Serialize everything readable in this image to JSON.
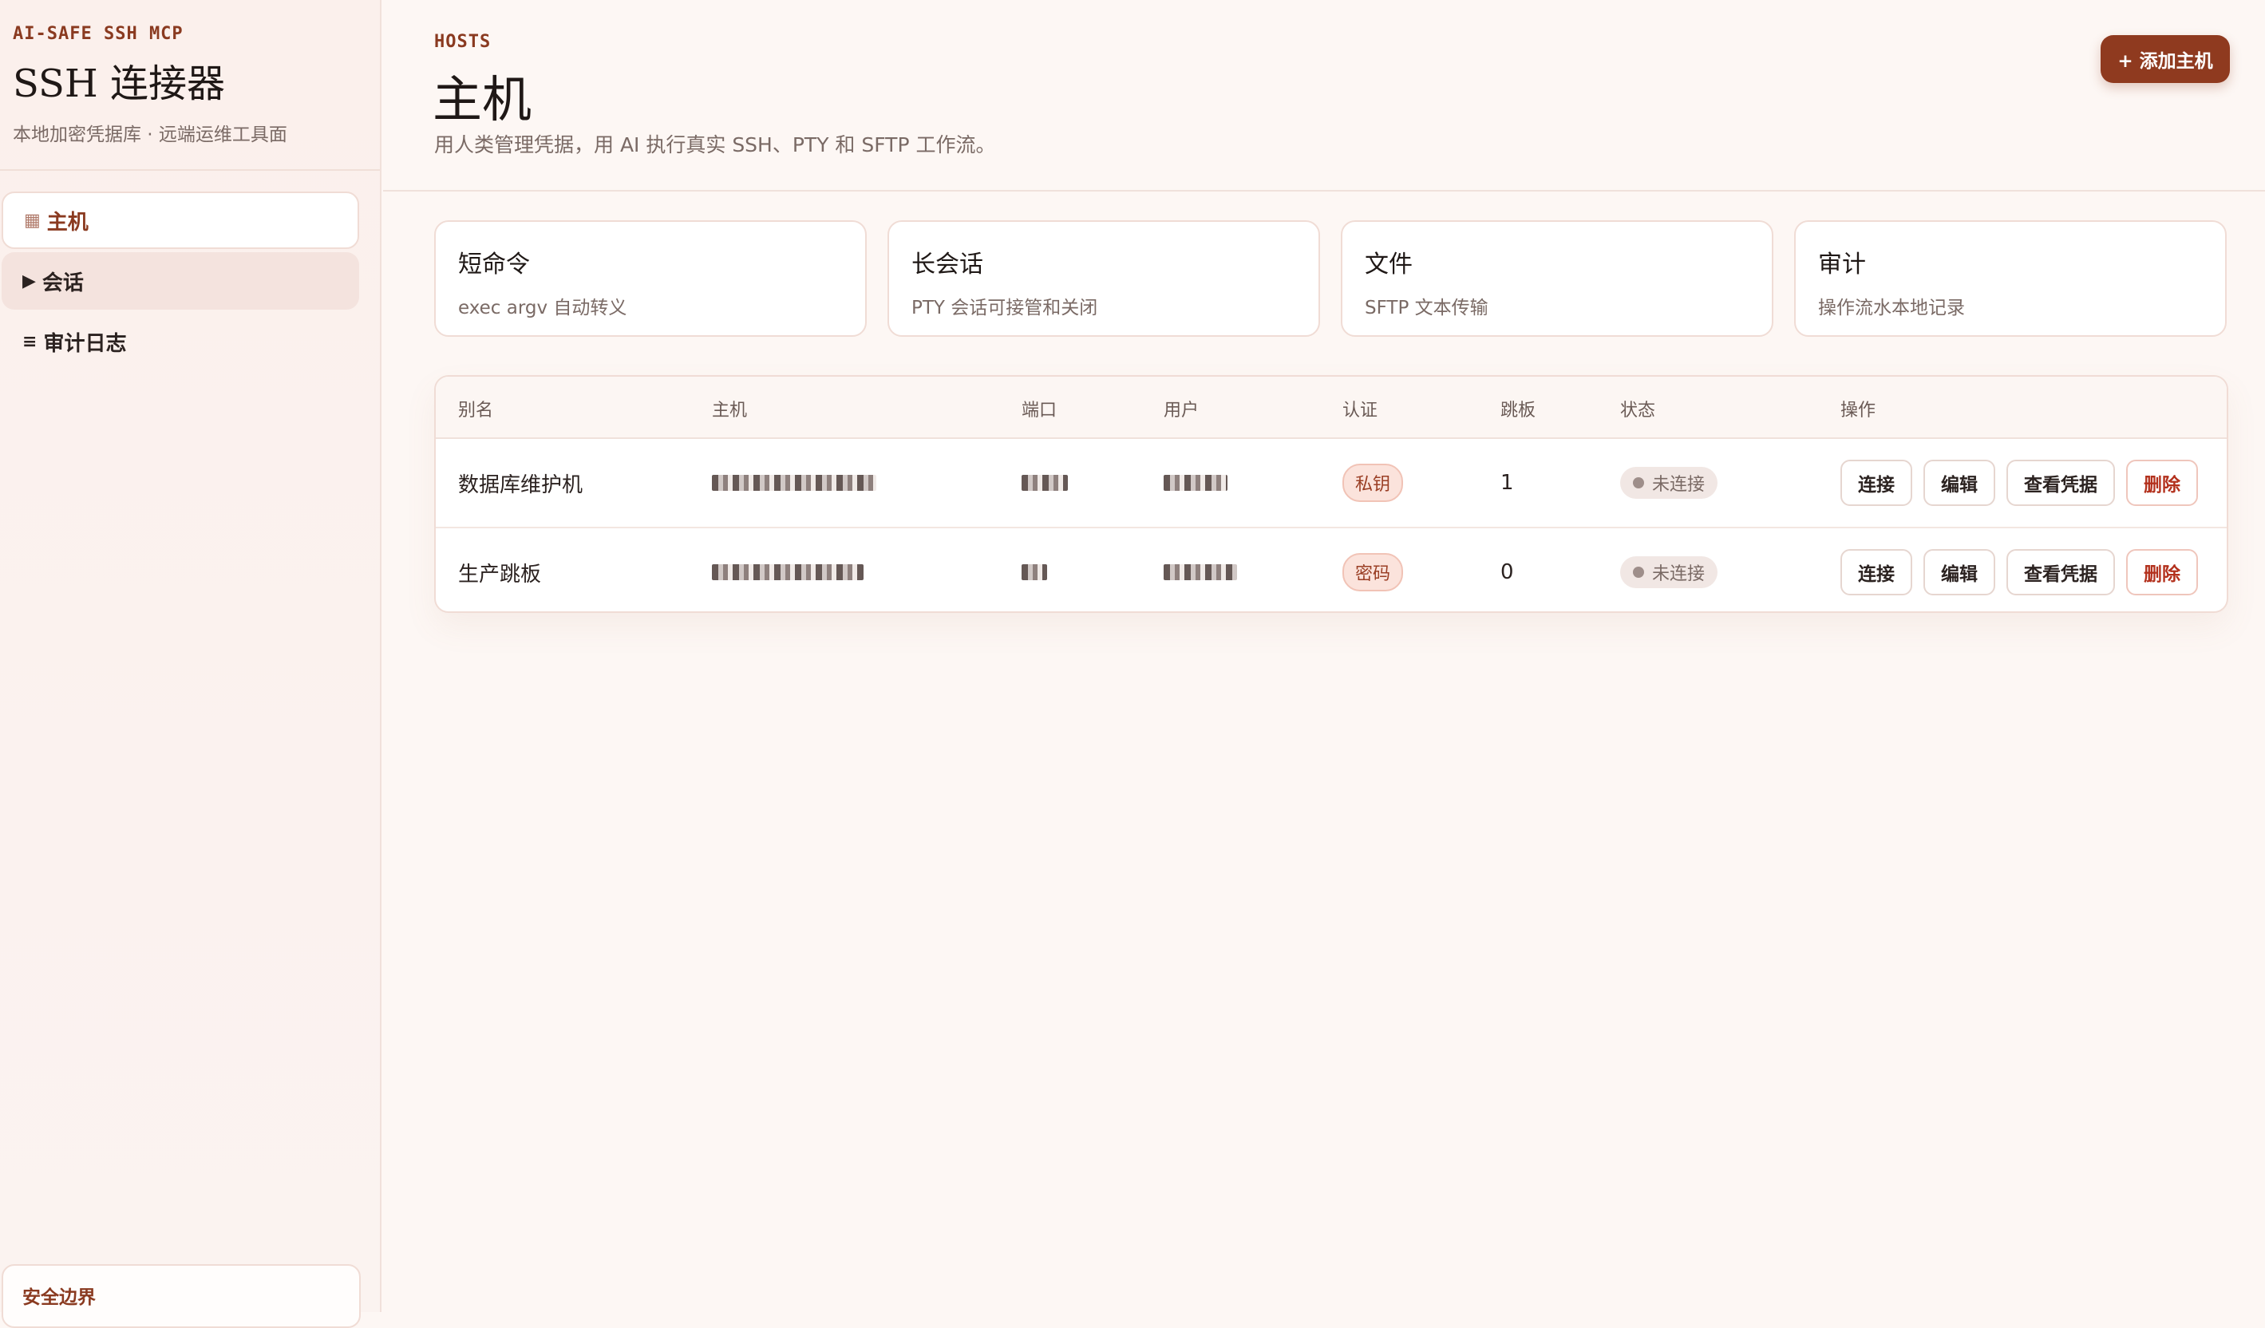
{
  "brand": {
    "eyebrow": "AI-SAFE SSH MCP",
    "title": "SSH 连接器",
    "subtitle": "本地加密凭据库 · 远端运维工具面"
  },
  "nav": [
    {
      "icon": "▦",
      "label": "主机",
      "icon_name": "grid-icon"
    },
    {
      "icon": "▶",
      "label": "会话",
      "icon_name": "play-icon"
    },
    {
      "icon": "≡",
      "label": "审计日志",
      "icon_name": "list-icon"
    }
  ],
  "sidebar_footer": {
    "label": "安全边界"
  },
  "header": {
    "eyebrow": "HOSTS",
    "title": "主机",
    "subtitle": "用人类管理凭据，用 AI 执行真实 SSH、PTY 和 SFTP 工作流。",
    "add_button": "+ 添加主机"
  },
  "cards": [
    {
      "title": "短命令",
      "desc": "exec argv 自动转义"
    },
    {
      "title": "长会话",
      "desc": "PTY 会话可接管和关闭"
    },
    {
      "title": "文件",
      "desc": "SFTP 文本传输"
    },
    {
      "title": "审计",
      "desc": "操作流水本地记录"
    }
  ],
  "table": {
    "columns": [
      "别名",
      "主机",
      "端口",
      "用户",
      "认证",
      "跳板",
      "状态",
      "操作"
    ],
    "rows": [
      {
        "alias": "数据库维护机",
        "auth": "私钥",
        "jump": "1",
        "status": "未连接"
      },
      {
        "alias": "生产跳板",
        "auth": "密码",
        "jump": "0",
        "status": "未连接"
      }
    ],
    "actions": [
      "连接",
      "编辑",
      "查看凭据",
      "删除"
    ]
  },
  "colors": {
    "accent": "#8f3a1f",
    "danger": "#b3311d",
    "background": "#fdf7f4"
  }
}
